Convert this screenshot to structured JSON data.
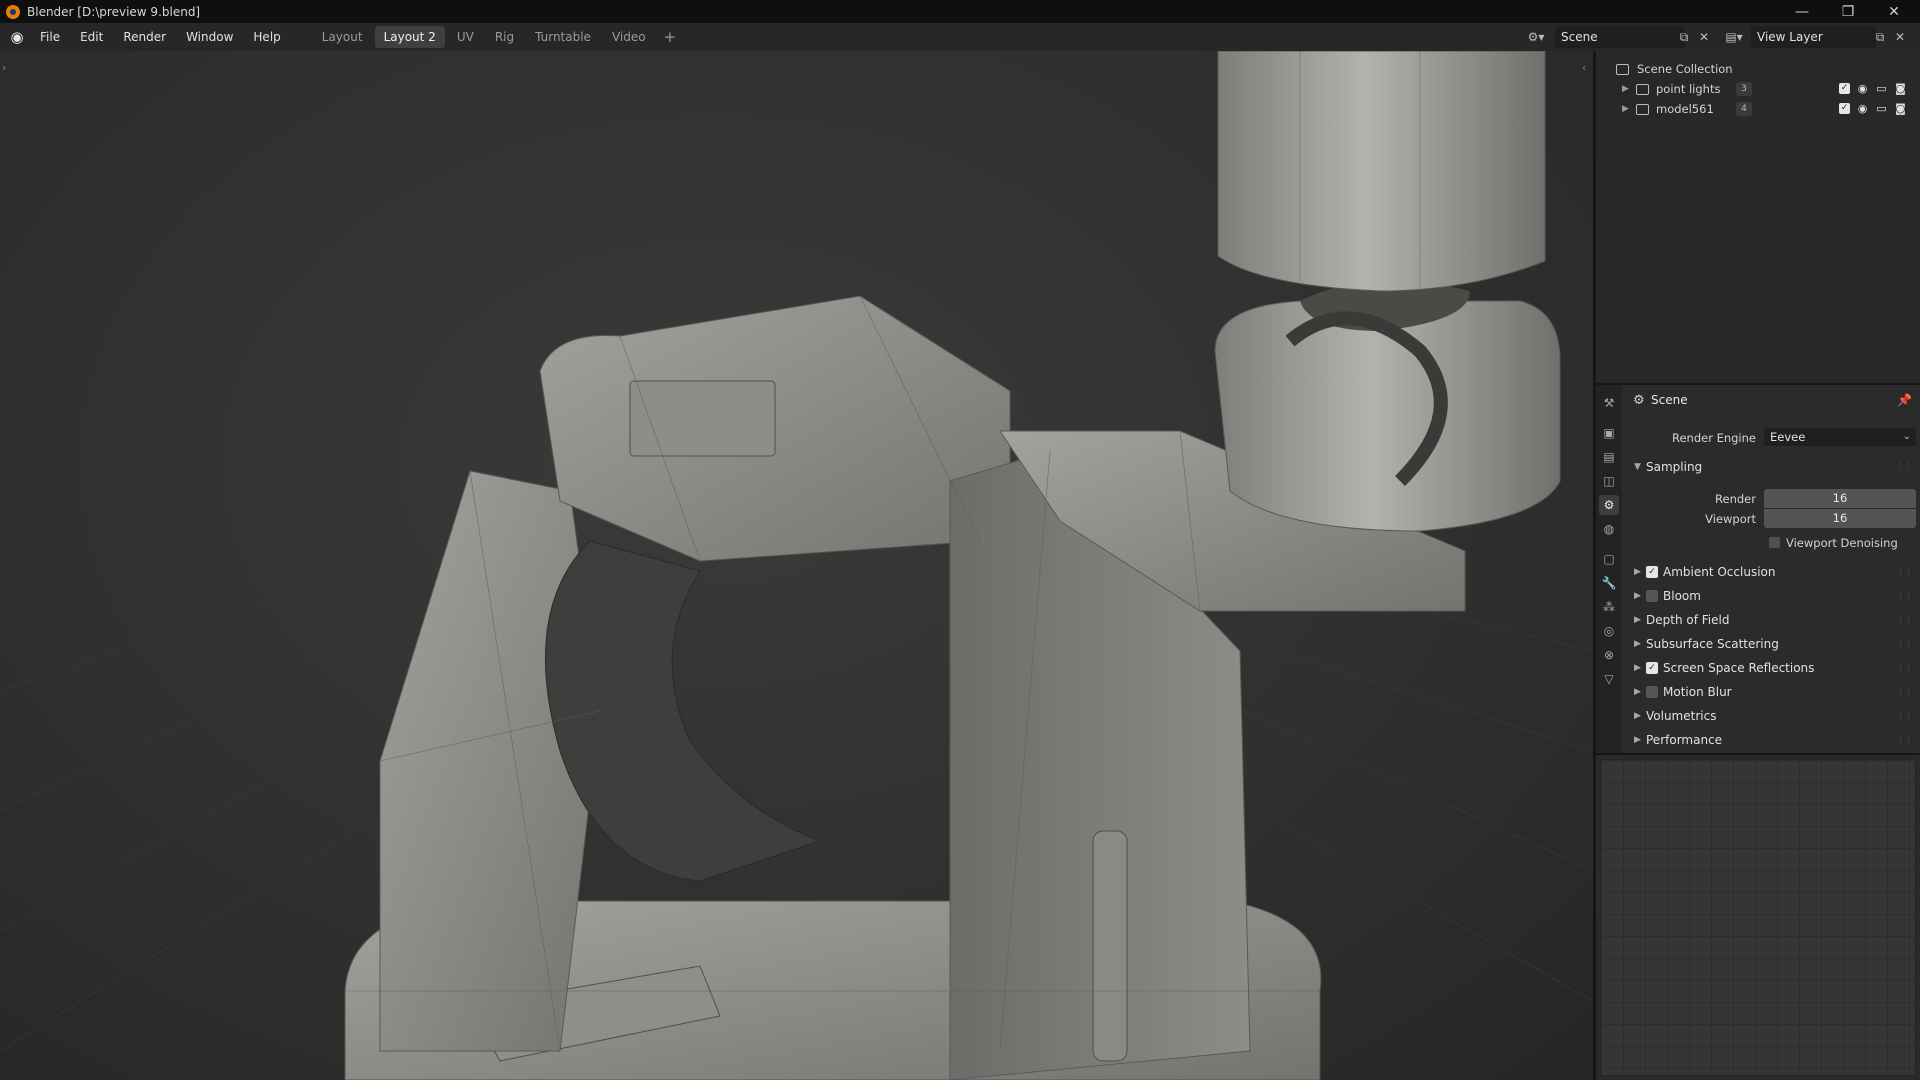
{
  "window": {
    "title": "Blender [D:\\preview 9.blend]",
    "minimize_icon": "—",
    "maximize_icon": "❐",
    "close_icon": "✕"
  },
  "menu": [
    "File",
    "Edit",
    "Render",
    "Window",
    "Help"
  ],
  "workspaces": {
    "tabs": [
      "Layout",
      "Layout 2",
      "UV",
      "Rig",
      "Turntable",
      "Video"
    ],
    "active": "Layout 2",
    "add_label": "+"
  },
  "scene_selector": {
    "value": "Scene"
  },
  "view_layer_selector": {
    "value": "View Layer"
  },
  "outliner": {
    "root": "Scene Collection",
    "collections": [
      {
        "name": "point lights",
        "badge": "3"
      },
      {
        "name": "model561",
        "badge": "4"
      }
    ]
  },
  "properties": {
    "context_title": "Scene",
    "render_engine_label": "Render Engine",
    "render_engine_value": "Eevee",
    "sampling": {
      "title": "Sampling",
      "render_label": "Render",
      "render_value": "16",
      "viewport_label": "Viewport",
      "viewport_value": "16",
      "viewport_denoising_label": "Viewport Denoising"
    },
    "panels": [
      {
        "label": "Ambient Occlusion",
        "checkbox": true,
        "checked": true
      },
      {
        "label": "Bloom",
        "checkbox": true,
        "checked": false
      },
      {
        "label": "Depth of Field",
        "checkbox": false
      },
      {
        "label": "Subsurface Scattering",
        "checkbox": false
      },
      {
        "label": "Screen Space Reflections",
        "checkbox": true,
        "checked": true
      },
      {
        "label": "Motion Blur",
        "checkbox": true,
        "checked": false
      },
      {
        "label": "Volumetrics",
        "checkbox": false
      },
      {
        "label": "Performance",
        "checkbox": false
      }
    ]
  },
  "colors": {
    "background": "#1d1d1d",
    "header": "#272727",
    "panel": "#2b2b2b",
    "accent": "#e87d0d",
    "model_base": "#8a8a86"
  }
}
